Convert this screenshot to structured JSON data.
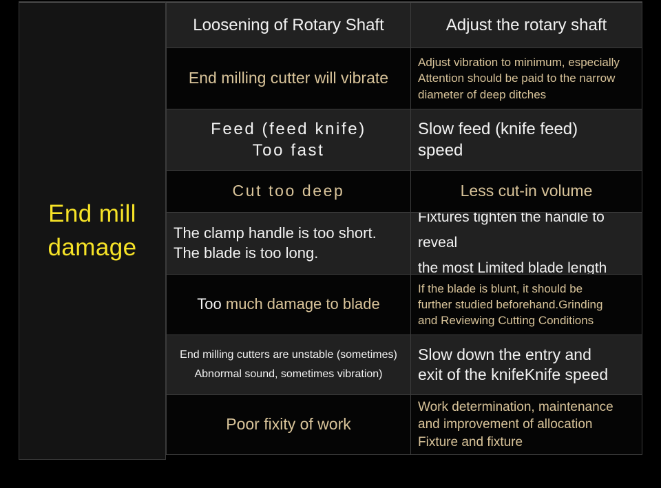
{
  "category": {
    "title": "End mill\ndamage",
    "color": "#F7E327"
  },
  "colors": {
    "tan": "#D9C49A",
    "white": "#F2F2F2",
    "row_light_bg": "#212121",
    "row_dark_bg": "#050505",
    "grid_line": "#3c3c3c",
    "page_bg": "#000000"
  },
  "rows": [
    {
      "cause": "Loosening of Rotary Shaft",
      "action": "Adjust the rotary shaft"
    },
    {
      "cause": "End milling cutter will vibrate",
      "action": "Adjust vibration to minimum, especially\nAttention should be paid to the narrow\ndiameter of deep ditches"
    },
    {
      "cause": "Feed (feed knife)\nToo fast",
      "action": "Slow feed (knife feed)\nspeed"
    },
    {
      "cause": "Cut too deep",
      "action": "Less cut-in volume"
    },
    {
      "cause": "The clamp handle is too short.\nThe blade is too long.",
      "action": "Fixtures tighten the handle to reveal\nthe most Limited blade length"
    },
    {
      "cause_prefix": "Too",
      "cause_rest": " much damage to blade",
      "cause": "Too much damage to blade",
      "action": "If the blade is blunt, it should be\nfurther studied beforehand.Grinding\nand Reviewing Cutting Conditions"
    },
    {
      "cause": "End milling cutters are unstable (sometimes)\nAbnormal sound, sometimes vibration)",
      "action": "Slow down the entry and\nexit of the knifeKnife speed"
    },
    {
      "cause": "Poor fixity of work",
      "action": "Work determination, maintenance\nand improvement of allocation\nFixture and fixture"
    }
  ]
}
